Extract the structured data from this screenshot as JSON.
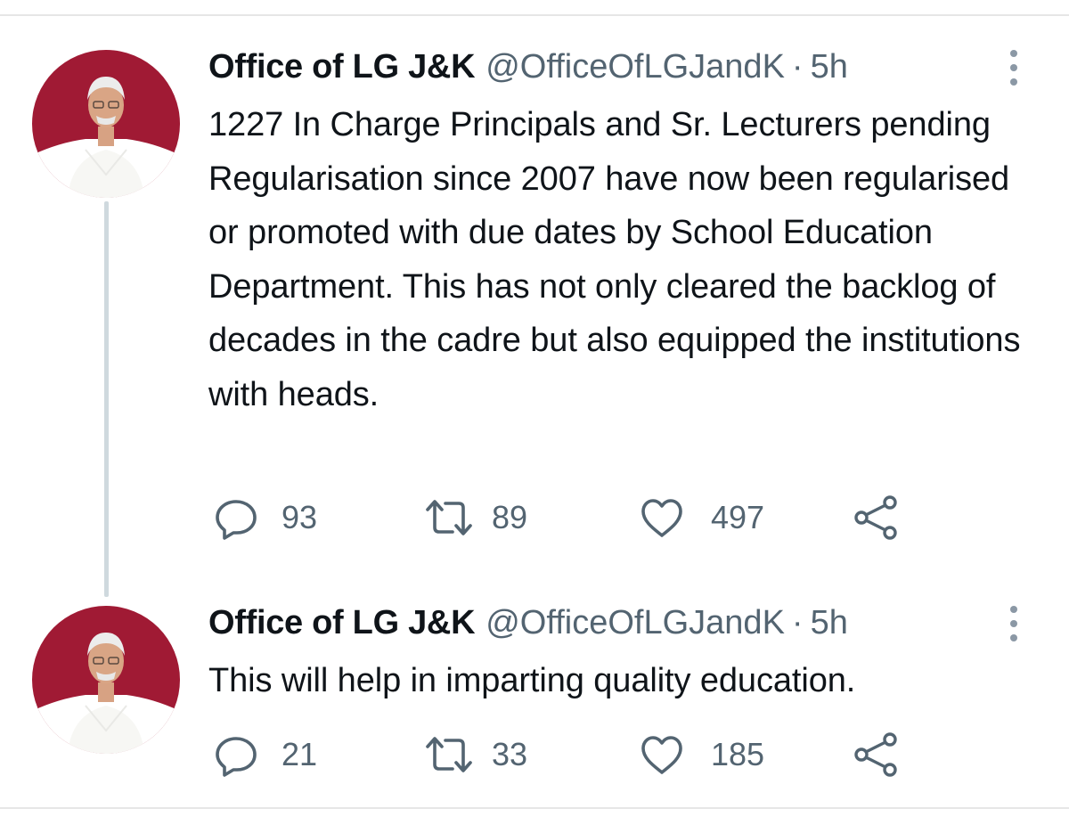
{
  "colors": {
    "avatar_bg": "#a01a34",
    "muted_text": "#536471",
    "primary_text": "#0f1419",
    "thread_line": "#cfd9de"
  },
  "tweets": [
    {
      "author_name": "Office of LG J&K",
      "handle": "@OfficeOfLGJandK",
      "separator": "·",
      "time": "5h",
      "text": "1227 In Charge Principals and Sr. Lecturers pending Regularisation since 2007 have now been regularised or promoted with due dates by School Education Department. This has not only cleared the backlog of decades in the cadre but also equipped the institutions with heads.",
      "replies": "93",
      "retweets": "89",
      "likes": "497",
      "icons": [
        "avatar",
        "more-options-icon",
        "reply-icon",
        "retweet-icon",
        "like-icon",
        "share-icon"
      ]
    },
    {
      "author_name": "Office of LG J&K",
      "handle": "@OfficeOfLGJandK",
      "separator": "·",
      "time": "5h",
      "text": "This will help in imparting quality education.",
      "replies": "21",
      "retweets": "33",
      "likes": "185",
      "icons": [
        "avatar",
        "more-options-icon",
        "reply-icon",
        "retweet-icon",
        "like-icon",
        "share-icon"
      ]
    }
  ]
}
